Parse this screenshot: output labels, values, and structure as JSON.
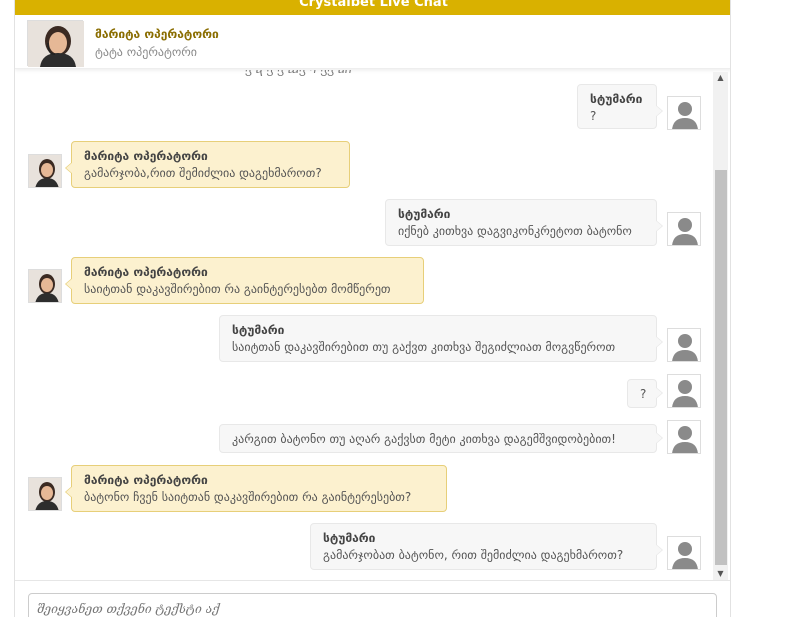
{
  "window": {
    "title": "Crystalbet Live Chat"
  },
  "header": {
    "operator_name": "მარიტა ოპერატორი",
    "operator_subtitle": "ტატა ოპერატორი"
  },
  "messages": [
    {
      "sender": "visitor",
      "name": "სტუმარი",
      "text": "?"
    },
    {
      "sender": "operator",
      "name": "მარიტა ოპერატორი",
      "text": "გამარჯობა,რით შემიძლია დაგეხმაროთ?"
    },
    {
      "sender": "visitor",
      "name": "სტუმარი",
      "text": "იქნებ კითხვა დაგვიკონკრეტოთ ბატონო"
    },
    {
      "sender": "operator",
      "name": "მარიტა ოპერატორი",
      "text": "საიტთან დაკავშირებით რა გაინტერესებთ მომწერეთ"
    },
    {
      "sender": "visitor",
      "name": "სტუმარი",
      "text": "საიტთან დაკავშირებით თუ გაქვთ კითხვა შეგიძლიათ მოგვწეროთ"
    },
    {
      "sender": "visitor",
      "name": "",
      "text": "?"
    },
    {
      "sender": "visitor",
      "name": "",
      "text": "კარგით ბატონო თუ აღარ გაქვსთ მეტი კითხვა დაგემშვიდობებით!"
    },
    {
      "sender": "operator",
      "name": "მარიტა ოპერატორი",
      "text": "ბატონო ჩვენ საიტთან დაკავშირებით რა გაინტერესებთ?"
    },
    {
      "sender": "visitor",
      "name": "სტუმარი",
      "text": "გამარჯობათ ბატონო, რით შემიძლია დაგეხმაროთ?"
    }
  ],
  "input": {
    "placeholder": "შეიყვანეთ თქვენი ტექსტი აქ"
  },
  "colors": {
    "brand": "#d9b100",
    "operator_bubble": "#fcf1cf",
    "operator_border": "#e7cf79",
    "visitor_bubble": "#f7f7f7"
  }
}
